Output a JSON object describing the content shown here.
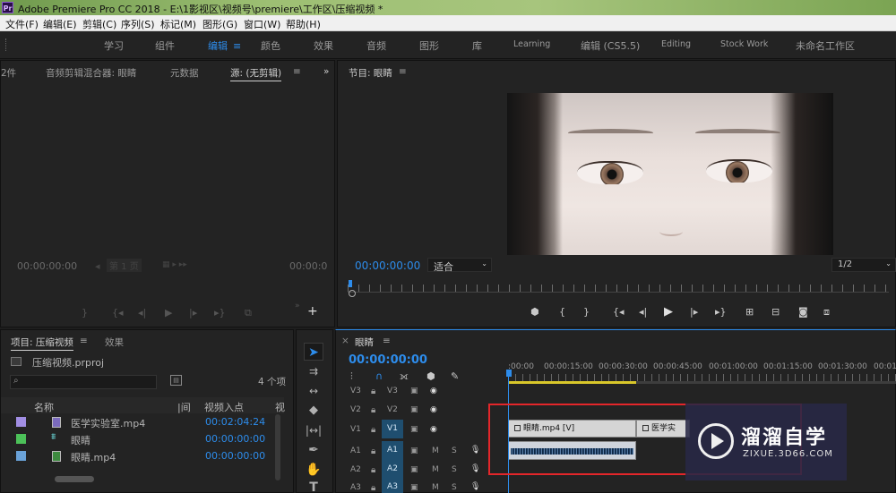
{
  "window": {
    "app_logo": "Pr",
    "title": "Adobe Premiere Pro CC 2018 - E:\\1影视区\\视频号\\premiere\\工作区\\压缩视频 *"
  },
  "menu": [
    "文件(F)",
    "编辑(E)",
    "剪辑(C)",
    "序列(S)",
    "标记(M)",
    "图形(G)",
    "窗口(W)",
    "帮助(H)"
  ],
  "workspaces": [
    {
      "label": "学习"
    },
    {
      "label": "组件"
    },
    {
      "label": "编辑",
      "active": true
    },
    {
      "label": "颜色"
    },
    {
      "label": "效果"
    },
    {
      "label": "音频"
    },
    {
      "label": "图形"
    },
    {
      "label": "库"
    },
    {
      "label": "Learning"
    },
    {
      "label": "编辑 (CS5.5)"
    },
    {
      "label": "Editing"
    },
    {
      "label": "Stock Work"
    },
    {
      "label": "未命名工作区"
    }
  ],
  "source_panel": {
    "tabs": [
      "2件",
      "音频剪辑混合器: 眼睛",
      "元数据",
      "源: (无剪辑)"
    ],
    "timecode_left": "00:00:00:00",
    "page_label": "第 1 页",
    "timecode_right": "00:00:0"
  },
  "program_panel": {
    "title": "节目: 眼睛",
    "timecode": "00:00:00:00",
    "fit": "适合",
    "resolution": "1/2"
  },
  "project_panel": {
    "tabs": [
      "项目: 压缩视频",
      "效果"
    ],
    "project_file": "压缩视频.prproj",
    "item_count": "4 个项",
    "columns": [
      "名称",
      "|间",
      "视频入点",
      "视"
    ],
    "items": [
      {
        "name": "医学实验室.mp4",
        "in_point": "00:02:04:24",
        "color": "#a18ee3"
      },
      {
        "name": "眼睛",
        "in_point": "00:00:00:00",
        "color": "#4cc159"
      },
      {
        "name": "眼睛.mp4",
        "in_point": "00:00:00:00",
        "color": "#6aa2d8"
      }
    ]
  },
  "timeline": {
    "sequence_tab": "眼睛",
    "timecode": "00:00:00:00",
    "ruler_labels": [
      ":00:00",
      "00:00:15:00",
      "00:00:30:00",
      "00:00:45:00",
      "00:01:00:00",
      "00:01:15:00",
      "00:01:30:00",
      "00:01:4"
    ],
    "tracks": [
      {
        "src": "V3",
        "target": "V3"
      },
      {
        "src": "V2",
        "target": "V2"
      },
      {
        "src": "V1",
        "target": "V1"
      },
      {
        "src": "A1",
        "target": "A1"
      },
      {
        "src": "A2",
        "target": "A2"
      },
      {
        "src": "A3",
        "target": "A3"
      }
    ],
    "clips": {
      "video1": "眼睛.mp4 [V]",
      "video2": "医学实"
    },
    "track_mute": "M",
    "track_solo": "S"
  },
  "watermark": {
    "brand": "溜溜自学",
    "url": "ZIXUE.3D66.COM"
  },
  "colors": {
    "accent": "#2d8ceb",
    "highlight_box": "#e3262a"
  }
}
